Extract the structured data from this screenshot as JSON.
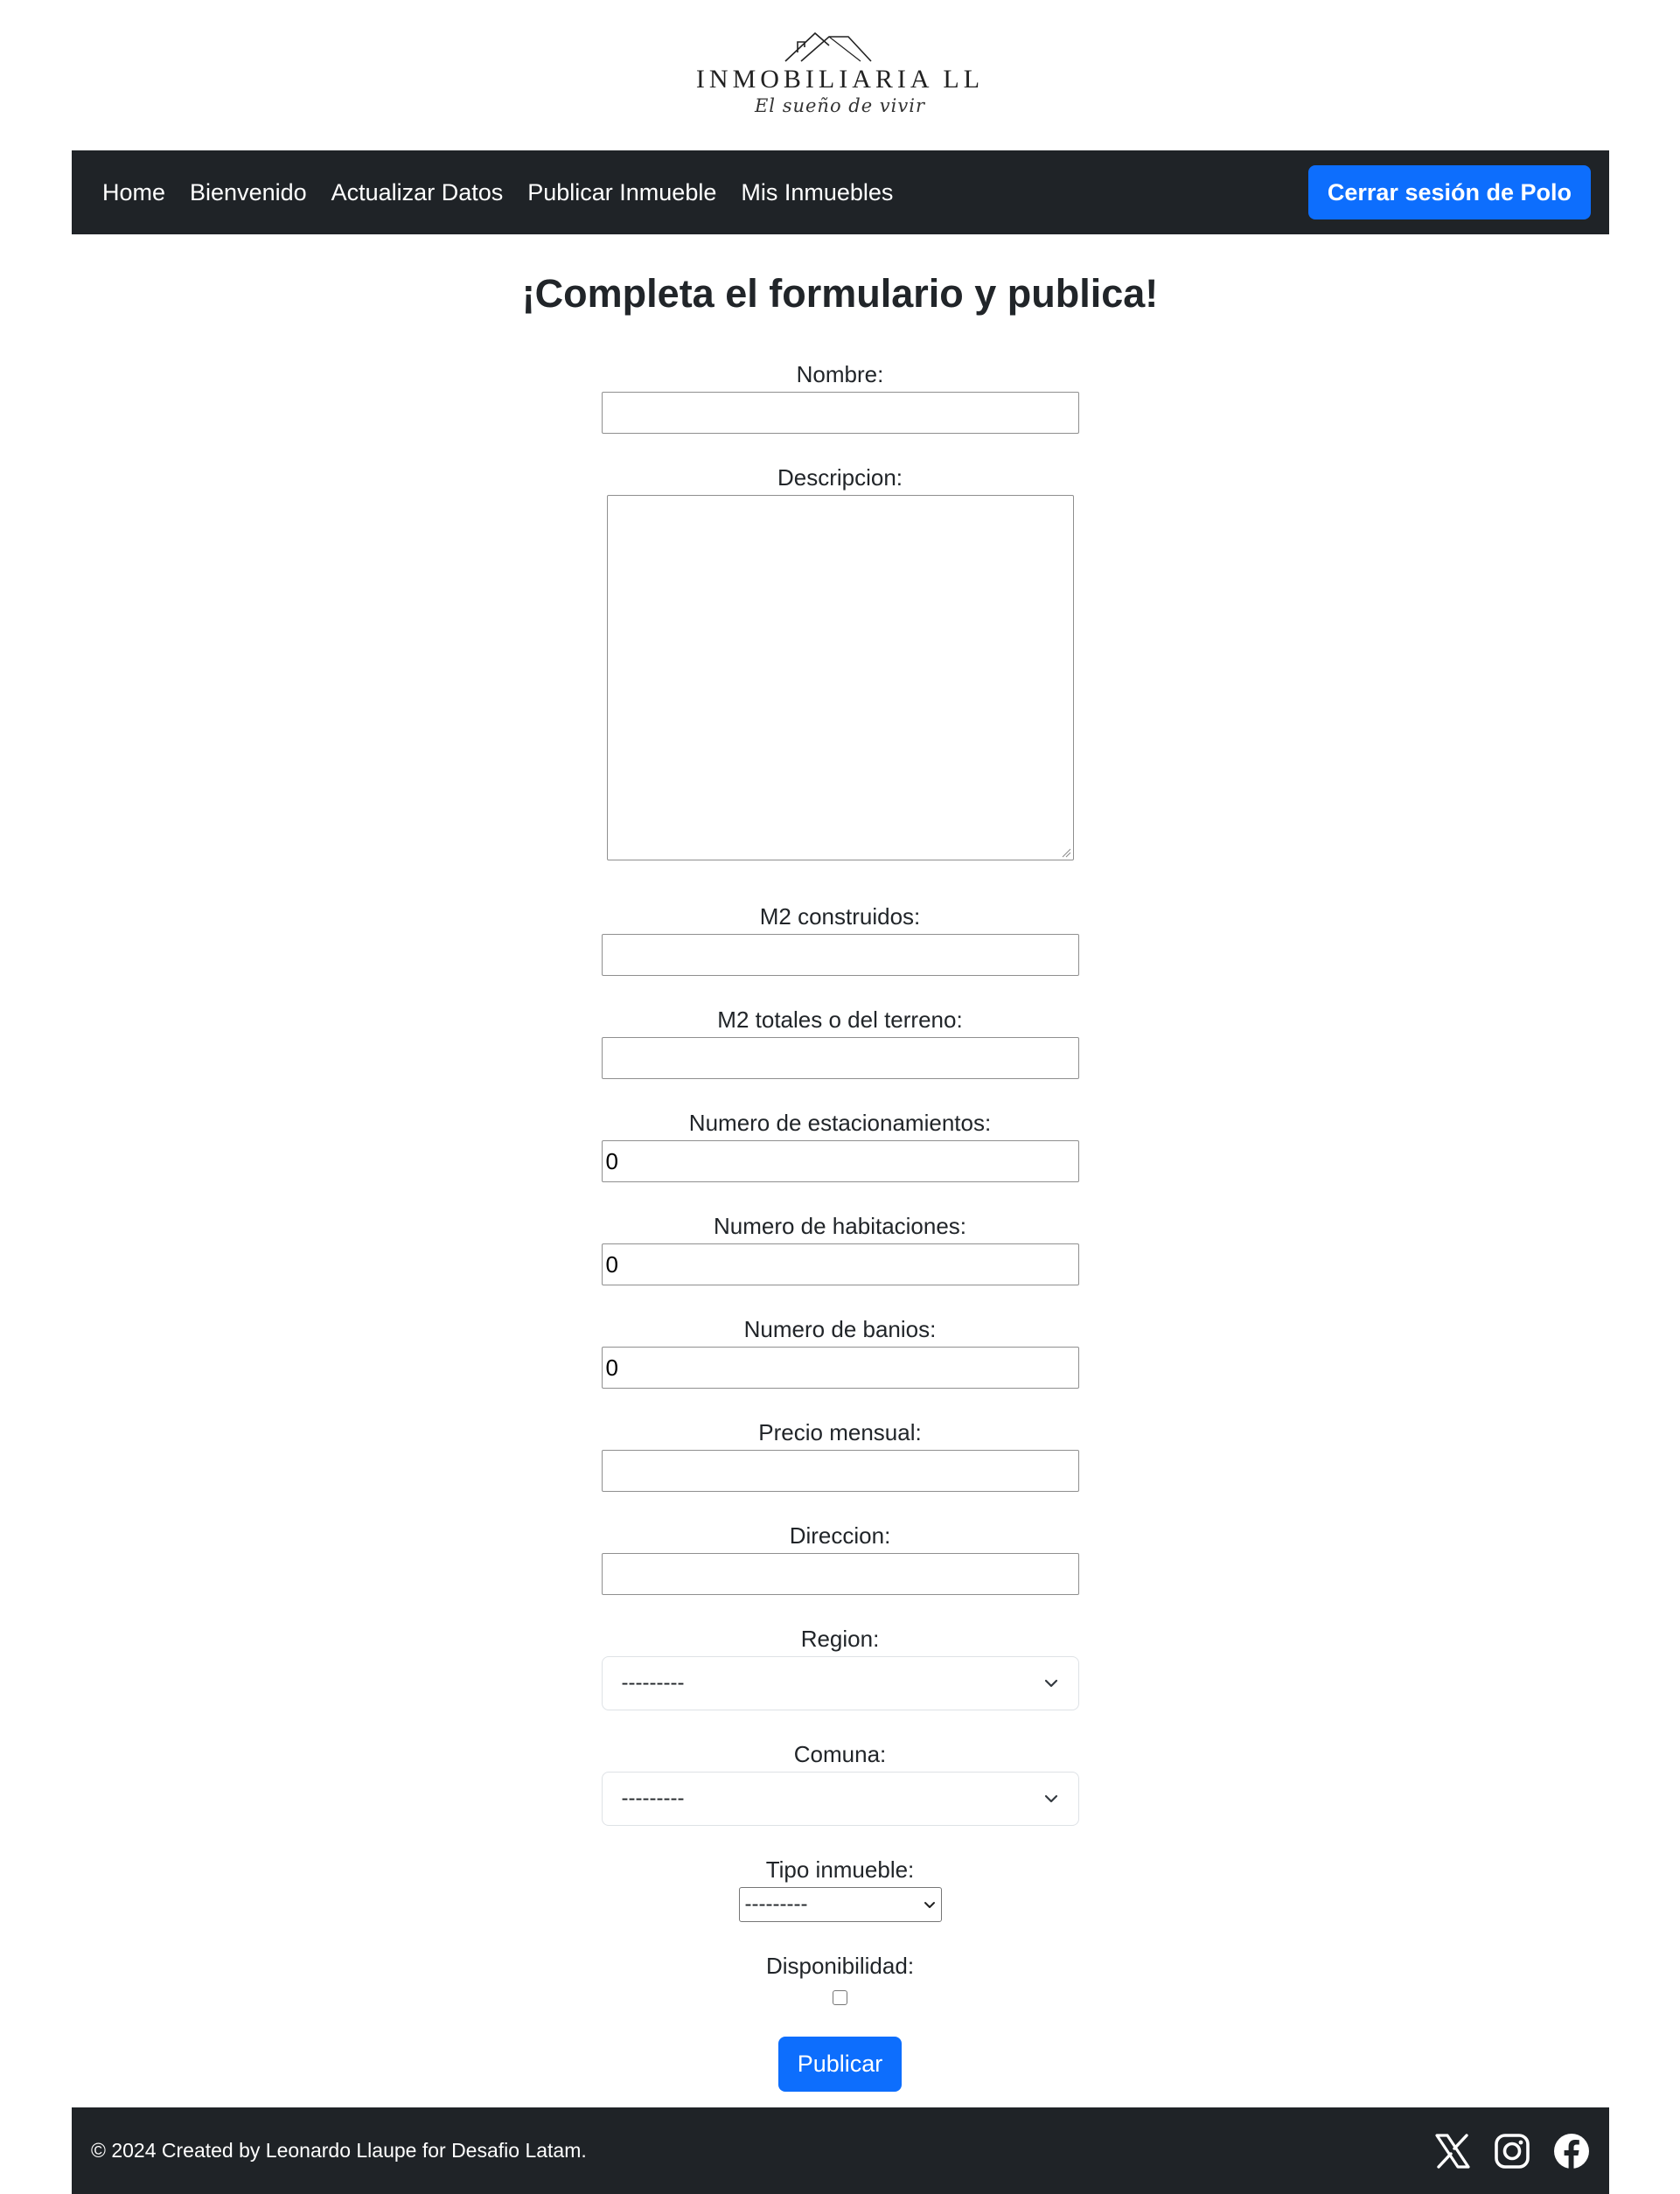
{
  "brand": {
    "name": "INMOBILIARIA LL",
    "tagline": "El sueño de vivir"
  },
  "nav": {
    "links": [
      "Home",
      "Bienvenido",
      "Actualizar Datos",
      "Publicar Inmueble",
      "Mis Inmuebles"
    ],
    "logout_label": "Cerrar sesión de Polo"
  },
  "form": {
    "title": "¡Completa el formulario y publica!",
    "fields": {
      "nombre": {
        "label": "Nombre:",
        "value": ""
      },
      "descripcion": {
        "label": "Descripcion:",
        "value": ""
      },
      "m2_construidos": {
        "label": "M2 construidos:",
        "value": ""
      },
      "m2_totales": {
        "label": "M2 totales o del terreno:",
        "value": ""
      },
      "estacionamientos": {
        "label": "Numero de estacionamientos:",
        "value": "0"
      },
      "habitaciones": {
        "label": "Numero de habitaciones:",
        "value": "0"
      },
      "banios": {
        "label": "Numero de banios:",
        "value": "0"
      },
      "precio": {
        "label": "Precio mensual:",
        "value": ""
      },
      "direccion": {
        "label": "Direccion:",
        "value": ""
      },
      "region": {
        "label": "Region:",
        "selected": "---------"
      },
      "comuna": {
        "label": "Comuna:",
        "selected": "---------"
      },
      "tipo_inmueble": {
        "label": "Tipo inmueble:",
        "selected": "---------"
      },
      "disponibilidad": {
        "label": "Disponibilidad:",
        "checked": false
      }
    },
    "submit_label": "Publicar"
  },
  "footer": {
    "text": "© 2024 Created by Leonardo Llaupe for Desafio Latam.",
    "social_icons": [
      "x-icon",
      "instagram-icon",
      "facebook-icon"
    ]
  },
  "colors": {
    "navbar_bg": "#1f2327",
    "primary": "#0d6efd",
    "text": "#212529"
  }
}
